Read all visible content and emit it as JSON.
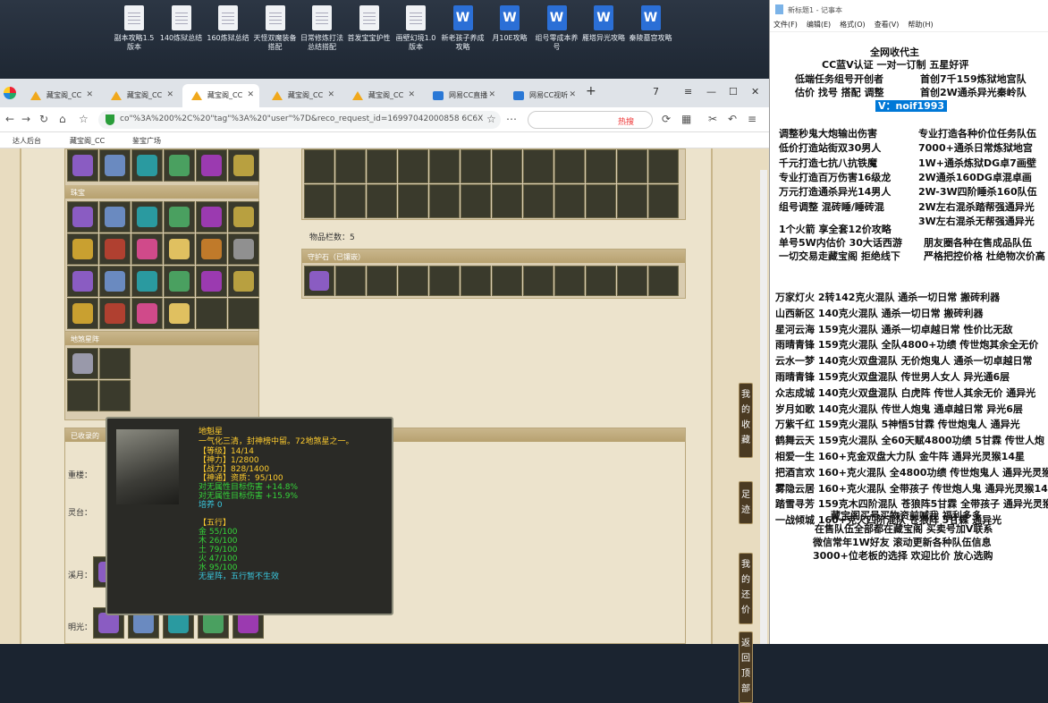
{
  "desktop": {
    "icons": [
      {
        "label": "副本攻略1.5版本",
        "kind": "doc"
      },
      {
        "label": "140炼狱总结",
        "kind": "doc"
      },
      {
        "label": "160炼狱总结",
        "kind": "doc"
      },
      {
        "label": "天怪双魔装备搭配",
        "kind": "doc"
      },
      {
        "label": "日常修炼打法总结搭配",
        "kind": "doc"
      },
      {
        "label": "首发宝宝护性",
        "kind": "doc"
      },
      {
        "label": "画壁幻境1.0版本",
        "kind": "doc"
      },
      {
        "label": "新老孩子养成攻略",
        "kind": "word"
      },
      {
        "label": "月10E攻略",
        "kind": "word"
      },
      {
        "label": "组号零成本养号",
        "kind": "word"
      },
      {
        "label": "雁塔异光攻略",
        "kind": "word"
      },
      {
        "label": "秦陵墓宫攻略",
        "kind": "word"
      }
    ]
  },
  "browser": {
    "tabs": [
      "藏宝阁_CC",
      "藏宝阁_CC",
      "藏宝阁_CC",
      "藏宝阁_CC",
      "藏宝阁_CC",
      "网易CC直播",
      "网易CC视听"
    ],
    "tab_count": "7",
    "url": "co\"%3A%200%2C%20\"tag\"%3A%20\"user\"%7D&reco_request_id=16997042000858 6C6X",
    "search_hot": "热搜",
    "bookmarks": [
      "达人后台",
      "藏宝阁_CC",
      "鉴宝广场"
    ]
  },
  "game": {
    "sec_zhubao": "珠宝",
    "sec_dishaxingzhen": "地煞星阵",
    "item_count_label": "物品栏数：5",
    "guard_stone": "守护石（已镶嵌）",
    "collected": "已收录的",
    "rows": [
      "重楼：",
      "灵台：",
      "溪月：",
      "明光："
    ],
    "side_buttons": [
      {
        "label": "我的收藏"
      },
      {
        "label": "足迹"
      },
      {
        "label": "我的还价"
      },
      {
        "label": "返回顶部"
      }
    ],
    "tooltip": {
      "name": "地魁星",
      "desc": "一气化三清，封神榜中留。72地煞星之一。",
      "lines": [
        {
          "t": "【等级】14/14",
          "c": "y"
        },
        {
          "t": "【神力】1/2800",
          "c": "y"
        },
        {
          "t": "【战力】828/1400",
          "c": "y"
        },
        {
          "t": "【神通】资质：95/100",
          "c": "y"
        },
        {
          "t": "对无属性目标伤害 +14.8%",
          "c": "g"
        },
        {
          "t": "对无属性目标伤害 +15.9%",
          "c": "g"
        },
        {
          "t": "培养 0",
          "c": "cy"
        },
        {
          "t": "",
          "c": "y"
        },
        {
          "t": "【五行】",
          "c": "y"
        },
        {
          "t": "金 55/100",
          "c": "g"
        },
        {
          "t": "木 26/100",
          "c": "g"
        },
        {
          "t": "土 79/100",
          "c": "g"
        },
        {
          "t": "火 47/100",
          "c": "g"
        },
        {
          "t": "水 95/100",
          "c": "g"
        },
        {
          "t": "无星阵，五行暂不生效",
          "c": "cy"
        }
      ]
    }
  },
  "notepad": {
    "title": "新标题1 - 记事本",
    "menu": [
      "文件(F)",
      "编辑(E)",
      "格式(O)",
      "查看(V)",
      "帮助(H)"
    ],
    "header": "全网收代主",
    "header2": "CC蓝V认证 一对一订制 五星好评",
    "lines_a": [
      [
        "低端任务组号开创者",
        "首创7千159炼狱地宫队"
      ],
      [
        "估价 找号 搭配 调整",
        "首创2W通杀异光秦岭队"
      ]
    ],
    "contact": "V：noif1993",
    "lines_b": [
      [
        "调整秒鬼大炮输出伤害",
        "专业打造各种价位任务队伍"
      ],
      [
        "低价打造站街双30男人",
        "7000+通杀日常炼狱地宫"
      ],
      [
        "千元打造七抗八抗铁魔",
        "1W+通杀炼狱DG卓7画壁"
      ],
      [
        "专业打造百万伤害16级龙",
        "2W通杀160DG卓混卓画"
      ],
      [
        "万元打造通杀异光14男人",
        "2W-3W四阶睡杀160队伍"
      ],
      [
        "组号调整 混砖睡/睡砖混",
        "2W左右混杀踏帮强通异光"
      ],
      [
        "",
        "3W左右混杀无帮强通异光"
      ]
    ],
    "lines_c": [
      [
        "1个火箭 享全套12价攻略",
        ""
      ],
      [
        "单号5W内估价 30大话西游",
        "朋友圈各种在售成品队伍"
      ],
      [
        "一切交易走藏宝阁 拒绝线下",
        "严格把控价格 杜绝物次价高"
      ]
    ],
    "teams": [
      "万家灯火 2转142克火混队 通杀一切日常 搬砖利器",
      "山西新区 140克火混队 通杀一切日常 搬砖利器",
      "星河云海 159克火混队 通杀一切卓越日常 性价比无敌",
      "雨晴青锋 159克火混队 全队4800+功绩 传世炮其余全无价",
      "云水一梦 140克火双盘混队 无价炮鬼人 通杀一切卓越日常",
      "雨晴青锋 159克火双盘混队 传世男人女人 异光通6层",
      "众志成城 140克火双盘混队 白虎阵 传世人其余无价 通异光",
      "岁月如歌 140克火混队 传世人炮鬼 通卓越日常 异光6层",
      "万紫千红 159克火混队 5神悟5甘霖 传世炮鬼人 通异光",
      "鹤舞云天 159克火混队 全60天赋4800功绩 5甘霖 传世人炮",
      "相爱一生 160+克金双盘大力队 金牛阵 通异光灵猴14星",
      "把酒言欢 160+克火混队 全4800功绩 传世炮鬼人 通异光灵猴",
      "雾隐云居 160+克火混队 全带孩子 传世炮人鬼 通异光灵猴14",
      "踏雪寻芳 159克木四阶混队 苍狼阵5甘霖 全带孩子 通异光灵猴",
      "一战倾城 160+克火四阶混队 苍狼阵 5甘霖 通异光"
    ],
    "footer": [
      "藏宝阁买号买物资前喊我 福利多多",
      "在售队伍全部都在藏宝阁 买卖号加V联系",
      "微信常年1W好友 滚动更新各种队伍信息",
      "3000+位老板的选择 欢迎比价 放心选购"
    ]
  }
}
